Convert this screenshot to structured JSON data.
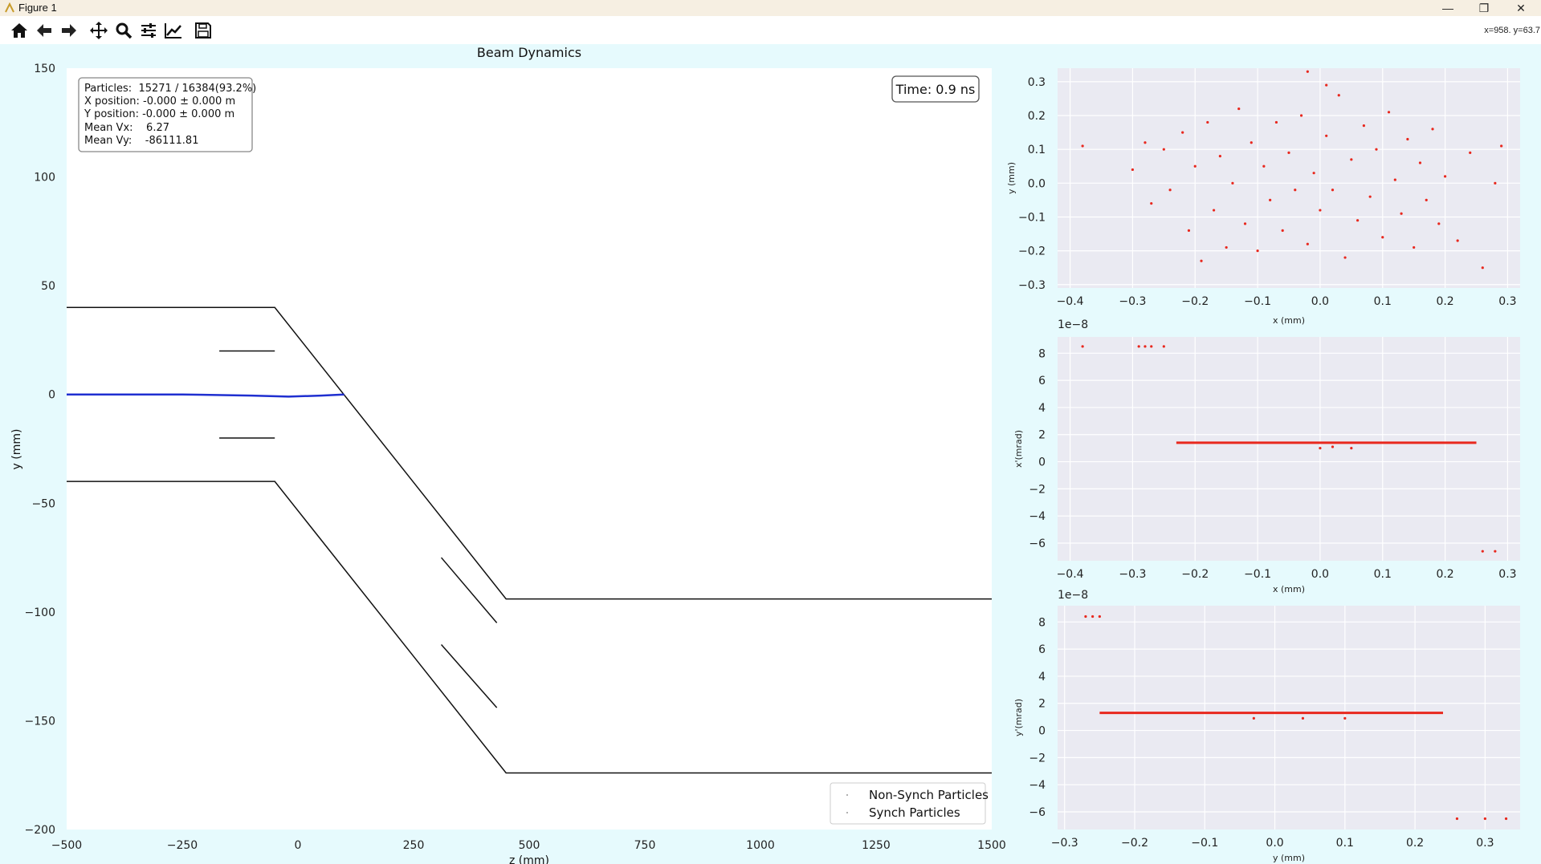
{
  "window": {
    "title": "Figure 1",
    "minimize_glyph": "—",
    "restore_glyph": "❐",
    "close_glyph": "✕"
  },
  "toolbar": {
    "buttons": [
      "home-icon",
      "back-arrow-icon",
      "forward-arrow-icon",
      "pan-move-icon",
      "zoom-magnifier-icon",
      "configure-subplots-icon",
      "edit-axis-icon",
      "save-floppy-icon"
    ],
    "coordinate_readout": "x=958. y=63.7"
  },
  "main_plot": {
    "title": "Beam Dynamics",
    "xlabel": "z (mm)",
    "ylabel": "y (mm)",
    "xlim": [
      -500,
      1500
    ],
    "ylim": [
      -200,
      150
    ],
    "xticks": [
      -500,
      -250,
      0,
      250,
      500,
      750,
      1000,
      1250,
      1500
    ],
    "xtick_labels": [
      "−500",
      "−250",
      "0",
      "250",
      "500",
      "750",
      "1000",
      "1250",
      "1500"
    ],
    "yticks": [
      150,
      100,
      50,
      0,
      -50,
      -100,
      -150,
      -200
    ],
    "ytick_labels": [
      "150",
      "100",
      "50",
      "0",
      "−50",
      "−100",
      "−150",
      "−200"
    ],
    "info_box": [
      "Particles:  15271 / 16384(93.2%)",
      "X position: -0.000 ± 0.000 m",
      "Y position: -0.000 ± 0.000 m",
      "Mean Vx:    6.27",
      "Mean Vy:    -86111.81"
    ],
    "time_label": "Time: 0.9 ns",
    "legend": [
      "Non-Synch Particles",
      "Synch Particles"
    ],
    "beam_color": "#1f2fd0",
    "walls": [
      [
        [
          -500,
          40
        ],
        [
          -50,
          40
        ],
        [
          450,
          -94
        ],
        [
          1500,
          -94
        ]
      ],
      [
        [
          -500,
          -40
        ],
        [
          -50,
          -40
        ],
        [
          450,
          -174
        ],
        [
          1500,
          -174
        ]
      ],
      [
        [
          -170,
          20
        ],
        [
          -50,
          20
        ]
      ],
      [
        [
          -170,
          -20
        ],
        [
          -50,
          -20
        ]
      ],
      [
        [
          310,
          -75
        ],
        [
          430,
          -105
        ]
      ],
      [
        [
          310,
          -115
        ],
        [
          430,
          -144
        ]
      ]
    ],
    "beam_path": [
      [
        -500,
        0
      ],
      [
        -250,
        0
      ],
      [
        -100,
        -0.5
      ],
      [
        -20,
        -1
      ],
      [
        50,
        -0.5
      ],
      [
        100,
        0
      ]
    ]
  },
  "chart_data": [
    {
      "type": "scatter",
      "xlabel": "x (mm)",
      "ylabel": "y (mm)",
      "xlim": [
        -0.42,
        0.32
      ],
      "ylim": [
        -0.31,
        0.34
      ],
      "xticks": [
        -0.4,
        -0.3,
        -0.2,
        -0.1,
        0.0,
        0.1,
        0.2,
        0.3
      ],
      "xtick_labels": [
        "−0.4",
        "−0.3",
        "−0.2",
        "−0.1",
        "0.0",
        "0.1",
        "0.2",
        "0.3"
      ],
      "yticks": [
        0.3,
        0.2,
        0.1,
        0.0,
        -0.1,
        -0.2,
        -0.3
      ],
      "ytick_labels": [
        "0.3",
        "0.2",
        "0.1",
        "0.0",
        "−0.1",
        "−0.2",
        "−0.3"
      ],
      "points": [
        [
          -0.38,
          0.11
        ],
        [
          -0.3,
          0.04
        ],
        [
          -0.28,
          0.12
        ],
        [
          -0.27,
          -0.06
        ],
        [
          -0.25,
          0.1
        ],
        [
          -0.24,
          -0.02
        ],
        [
          -0.22,
          0.15
        ],
        [
          -0.21,
          -0.14
        ],
        [
          -0.2,
          0.05
        ],
        [
          -0.19,
          -0.23
        ],
        [
          -0.18,
          0.18
        ],
        [
          -0.17,
          -0.08
        ],
        [
          -0.16,
          0.08
        ],
        [
          -0.15,
          -0.19
        ],
        [
          -0.14,
          0.0
        ],
        [
          -0.13,
          0.22
        ],
        [
          -0.12,
          -0.12
        ],
        [
          -0.11,
          0.12
        ],
        [
          -0.1,
          -0.2
        ],
        [
          -0.09,
          0.05
        ],
        [
          -0.08,
          -0.05
        ],
        [
          -0.07,
          0.18
        ],
        [
          -0.06,
          -0.14
        ],
        [
          -0.05,
          0.09
        ],
        [
          -0.04,
          -0.02
        ],
        [
          -0.03,
          0.2
        ],
        [
          -0.02,
          -0.18
        ],
        [
          -0.01,
          0.03
        ],
        [
          0.0,
          -0.08
        ],
        [
          0.01,
          0.14
        ],
        [
          0.02,
          -0.02
        ],
        [
          0.03,
          0.26
        ],
        [
          0.04,
          -0.22
        ],
        [
          0.05,
          0.07
        ],
        [
          0.06,
          -0.11
        ],
        [
          0.07,
          0.17
        ],
        [
          0.08,
          -0.04
        ],
        [
          0.09,
          0.1
        ],
        [
          0.1,
          -0.16
        ],
        [
          0.11,
          0.21
        ],
        [
          0.12,
          0.01
        ],
        [
          0.13,
          -0.09
        ],
        [
          0.14,
          0.13
        ],
        [
          0.15,
          -0.19
        ],
        [
          0.16,
          0.06
        ],
        [
          0.17,
          -0.05
        ],
        [
          0.18,
          0.16
        ],
        [
          0.19,
          -0.12
        ],
        [
          0.2,
          0.02
        ],
        [
          0.22,
          -0.17
        ],
        [
          0.24,
          0.09
        ],
        [
          0.26,
          -0.25
        ],
        [
          0.28,
          0.0
        ],
        [
          0.29,
          0.11
        ],
        [
          -0.02,
          0.33
        ],
        [
          0.01,
          0.29
        ]
      ]
    },
    {
      "type": "scatter",
      "xlabel": "x (mm)",
      "ylabel": "x'(mrad)",
      "exponent_label": "1e−8",
      "xlim": [
        -0.42,
        0.32
      ],
      "ylim": [
        -7.3,
        9.2
      ],
      "xticks": [
        -0.4,
        -0.3,
        -0.2,
        -0.1,
        0.0,
        0.1,
        0.2,
        0.3
      ],
      "xtick_labels": [
        "−0.4",
        "−0.3",
        "−0.2",
        "−0.1",
        "0.0",
        "0.1",
        "0.2",
        "0.3"
      ],
      "yticks": [
        8,
        6,
        4,
        2,
        0,
        -2,
        -4,
        -6
      ],
      "ytick_labels": [
        "8",
        "6",
        "4",
        "2",
        "0",
        "−2",
        "−4",
        "−6"
      ],
      "line_segment": {
        "x": [
          -0.23,
          0.25
        ],
        "y": 1.4
      },
      "points": [
        [
          -0.38,
          8.5
        ],
        [
          -0.29,
          8.5
        ],
        [
          -0.28,
          8.5
        ],
        [
          -0.27,
          8.5
        ],
        [
          -0.25,
          8.5
        ],
        [
          0.26,
          -6.6
        ],
        [
          0.28,
          -6.6
        ],
        [
          0.0,
          1.0
        ],
        [
          0.02,
          1.1
        ],
        [
          0.05,
          1.0
        ]
      ]
    },
    {
      "type": "scatter",
      "xlabel": "y (mm)",
      "ylabel": "y'(mrad)",
      "exponent_label": "1e−8",
      "xlim": [
        -0.31,
        0.35
      ],
      "ylim": [
        -7.3,
        9.2
      ],
      "xticks": [
        -0.3,
        -0.2,
        -0.1,
        0.0,
        0.1,
        0.2,
        0.3
      ],
      "xtick_labels": [
        "−0.3",
        "−0.2",
        "−0.1",
        "0.0",
        "0.1",
        "0.2",
        "0.3"
      ],
      "yticks": [
        8,
        6,
        4,
        2,
        0,
        -2,
        -4,
        -6
      ],
      "ytick_labels": [
        "8",
        "6",
        "4",
        "2",
        "0",
        "−2",
        "−4",
        "−6"
      ],
      "line_segment": {
        "x": [
          -0.25,
          0.24
        ],
        "y": 1.3
      },
      "points": [
        [
          -0.27,
          8.4
        ],
        [
          -0.26,
          8.4
        ],
        [
          -0.25,
          8.4
        ],
        [
          0.26,
          -6.5
        ],
        [
          0.3,
          -6.5
        ],
        [
          0.33,
          -6.5
        ],
        [
          -0.03,
          0.9
        ],
        [
          0.04,
          0.9
        ],
        [
          0.1,
          0.9
        ]
      ]
    }
  ]
}
